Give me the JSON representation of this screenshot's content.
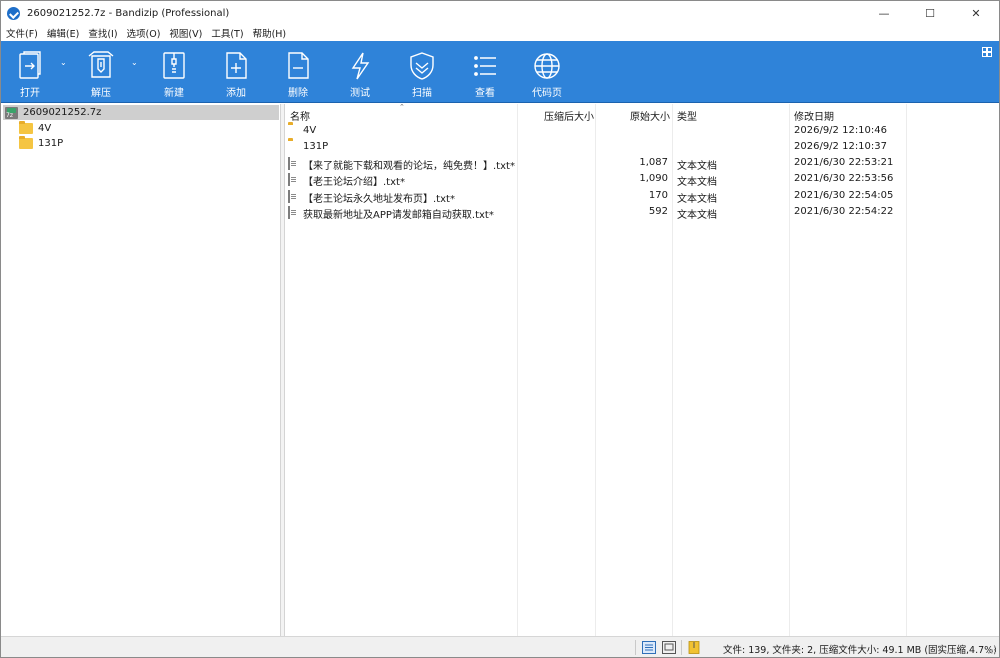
{
  "window": {
    "title": "2609021252.7z - Bandizip (Professional)",
    "controls": {
      "minimize": "—",
      "maximize": "☐",
      "close": "✕"
    }
  },
  "menu": [
    "文件(F)",
    "编辑(E)",
    "查找(I)",
    "选项(O)",
    "视图(V)",
    "工具(T)",
    "帮助(H)"
  ],
  "toolbar": {
    "open": "打开",
    "extract": "解压",
    "new": "新建",
    "add": "添加",
    "delete": "删除",
    "test": "测试",
    "scan": "扫描",
    "view": "查看",
    "codepage": "代码页",
    "dropdown_arrow": "⌄",
    "accent_color": "#2f83d9"
  },
  "tree": {
    "root": "2609021252.7z",
    "children": [
      "4V",
      "131P"
    ]
  },
  "columns": {
    "name": "名称",
    "compressed": "压缩后大小",
    "original": "原始大小",
    "type": "类型",
    "modified": "修改日期",
    "sort_indicator": "⌃"
  },
  "files": [
    {
      "name": "4V",
      "compressed": "",
      "original": "",
      "type": "",
      "modified": "2026/9/2 12:10:46",
      "kind": "folder"
    },
    {
      "name": "131P",
      "compressed": "",
      "original": "",
      "type": "",
      "modified": "2026/9/2 12:10:37",
      "kind": "folder"
    },
    {
      "name": "【来了就能下载和观看的论坛，纯免费！】.txt*",
      "compressed": "",
      "original": "1,087",
      "type": "文本文档",
      "modified": "2021/6/30 22:53:21",
      "kind": "file"
    },
    {
      "name": "【老王论坛介绍】.txt*",
      "compressed": "",
      "original": "1,090",
      "type": "文本文档",
      "modified": "2021/6/30 22:53:56",
      "kind": "file"
    },
    {
      "name": "【老王论坛永久地址发布页】.txt*",
      "compressed": "",
      "original": "170",
      "type": "文本文档",
      "modified": "2021/6/30 22:54:05",
      "kind": "file"
    },
    {
      "name": "获取最新地址及APP请发邮箱自动获取.txt*",
      "compressed": "",
      "original": "592",
      "type": "文本文档",
      "modified": "2021/6/30 22:54:22",
      "kind": "file"
    }
  ],
  "status": {
    "summary": "文件: 139, 文件夹: 2, 压缩文件大小: 49.1 MB (固实压缩,4.7%)"
  }
}
